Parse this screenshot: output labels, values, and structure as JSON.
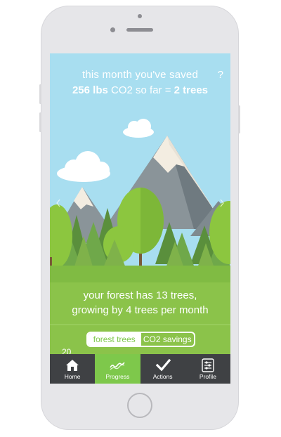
{
  "header": {
    "line1": "this month you've saved",
    "line2_amount": "256 lbs",
    "line2_mid": " CO2 so far = ",
    "line2_trees": "2 trees",
    "help": "?"
  },
  "forest": {
    "line1": "your forest has 13 trees,",
    "line2": "growing by 4 trees per month"
  },
  "toggle": {
    "option1": "forest trees",
    "option2": "CO2 savings",
    "selected": "forest trees"
  },
  "axis_label": "20",
  "nav": {
    "items": [
      {
        "label": "Home",
        "icon": "home-icon"
      },
      {
        "label": "Progress",
        "icon": "progress-icon",
        "active": true
      },
      {
        "label": "Actions",
        "icon": "checkmark-icon"
      },
      {
        "label": "Profile",
        "icon": "profile-icon"
      }
    ]
  },
  "colors": {
    "sky": "#a8def0",
    "grass": "#8bc34a",
    "accent_green": "#7ec84b",
    "nav_bg": "#3f4144"
  }
}
